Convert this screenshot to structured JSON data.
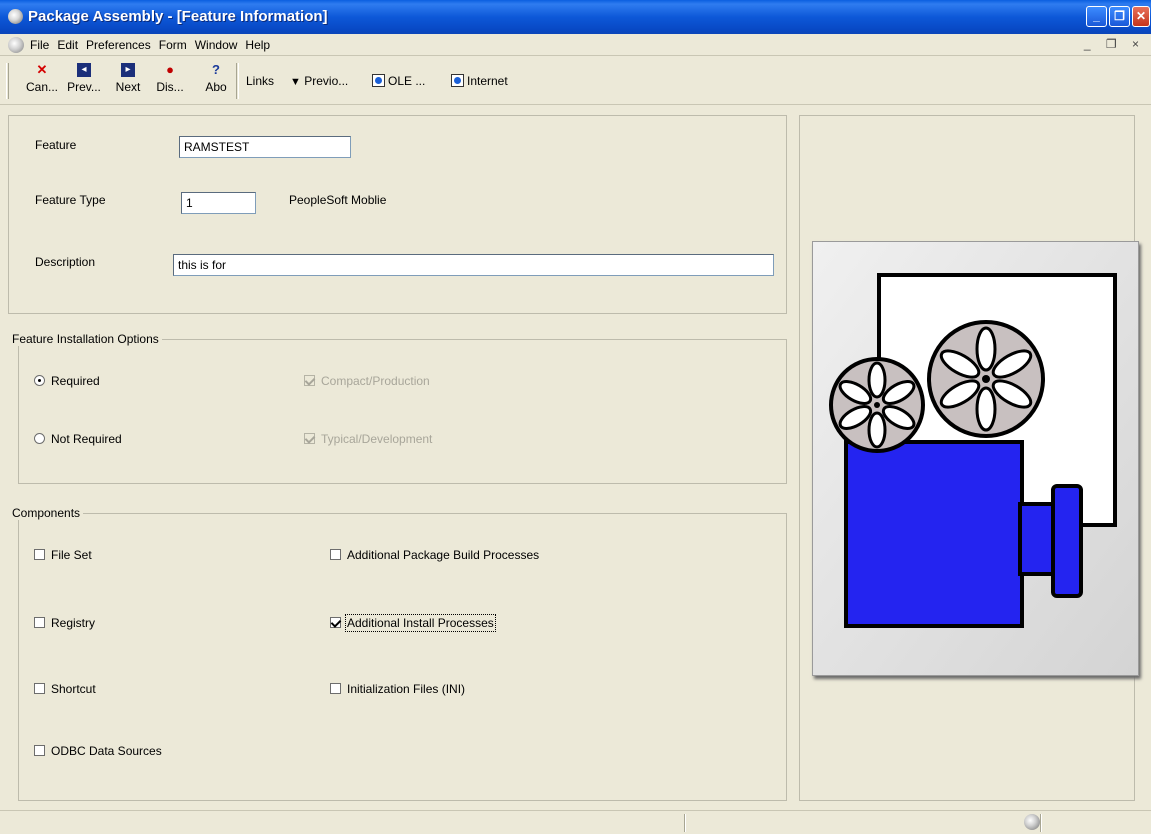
{
  "window": {
    "title": "Package Assembly - [Feature Information]",
    "minimize_glyph": "_",
    "restore_glyph": "❐",
    "close_glyph": "✕",
    "mdi_controls": "_ ❐ ×"
  },
  "menu": {
    "items": [
      "File",
      "Edit",
      "Preferences",
      "Form",
      "Window",
      "Help"
    ]
  },
  "toolbar": {
    "buttons": [
      {
        "label": "Can...",
        "icon": "cancel-x-icon"
      },
      {
        "label": "Prev...",
        "icon": "previous-arrow-icon"
      },
      {
        "label": "Next",
        "icon": "next-arrow-icon"
      },
      {
        "label": "Dis...",
        "icon": "display-icon"
      },
      {
        "label": "Abo",
        "icon": "about-help-icon"
      }
    ],
    "links_label": "Links",
    "previous_label": "Previo...",
    "ole_label": "OLE ...",
    "internet_label": "Internet"
  },
  "form": {
    "feature_label": "Feature",
    "feature_value": "RAMSTEST",
    "feature_type_label": "Feature Type",
    "feature_type_value": "1",
    "feature_type_desc": "PeopleSoft Moblie",
    "description_label": "Description",
    "description_value": "this is for"
  },
  "install_options": {
    "title": "Feature Installation Options",
    "required_label": "Required",
    "not_required_label": "Not Required",
    "compact_label": "Compact/Production",
    "typical_label": "Typical/Development",
    "selected": "Required",
    "compact_checked": true,
    "typical_checked": true
  },
  "components": {
    "title": "Components",
    "file_set": "File Set",
    "registry": "Registry",
    "shortcut": "Shortcut",
    "odbc": "ODBC Data Sources",
    "additional_build": "Additional Package Build Processes",
    "additional_install": "Additional Install Processes",
    "ini_files": "Initialization Files (INI)",
    "additional_install_checked": true
  },
  "colors": {
    "titlebar": "#0d58d8",
    "window_bg": "#ece9d8",
    "projector_body": "#2424f0",
    "reel": "#c8c0c0"
  }
}
